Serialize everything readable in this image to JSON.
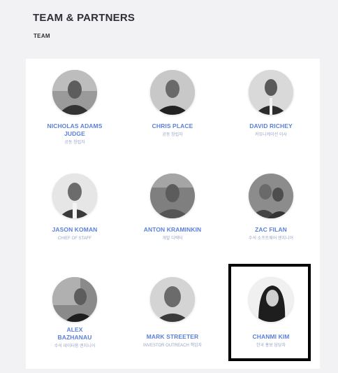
{
  "header": {
    "title": "TEAM & PARTNERS",
    "subtitle": "TEAM"
  },
  "team": [
    {
      "name": "NICHOLAS ADAMS JUDGE",
      "role": "공동 창립자",
      "avatar": "person-photo-icon"
    },
    {
      "name": "CHRIS PLACE",
      "role": "공동 창립자",
      "avatar": "person-photo-icon"
    },
    {
      "name": "DAVID RICHEY",
      "role": "커뮤니케이션 이사",
      "avatar": "person-photo-icon"
    },
    {
      "name": "JASON KOMAN",
      "role": "CHIEF OF STAFF",
      "avatar": "person-photo-icon"
    },
    {
      "name": "ANTON KRAMINKIN",
      "role": "개발 디렉터",
      "avatar": "person-photo-icon"
    },
    {
      "name": "ZAC FILAN",
      "role": "수석 소프트웨어 엔지니어",
      "avatar": "person-photo-icon"
    },
    {
      "name": "ALEX BAZHANAU",
      "role": "수석 데이터용 엔지니어",
      "avatar": "person-photo-icon"
    },
    {
      "name": "MARK STREETER",
      "role": "INVESTOR OUTREACH 책임자",
      "avatar": "person-photo-icon"
    },
    {
      "name": "CHANMI KIM",
      "role": "한국 홍보 담당자",
      "avatar": "person-photo-icon"
    }
  ]
}
